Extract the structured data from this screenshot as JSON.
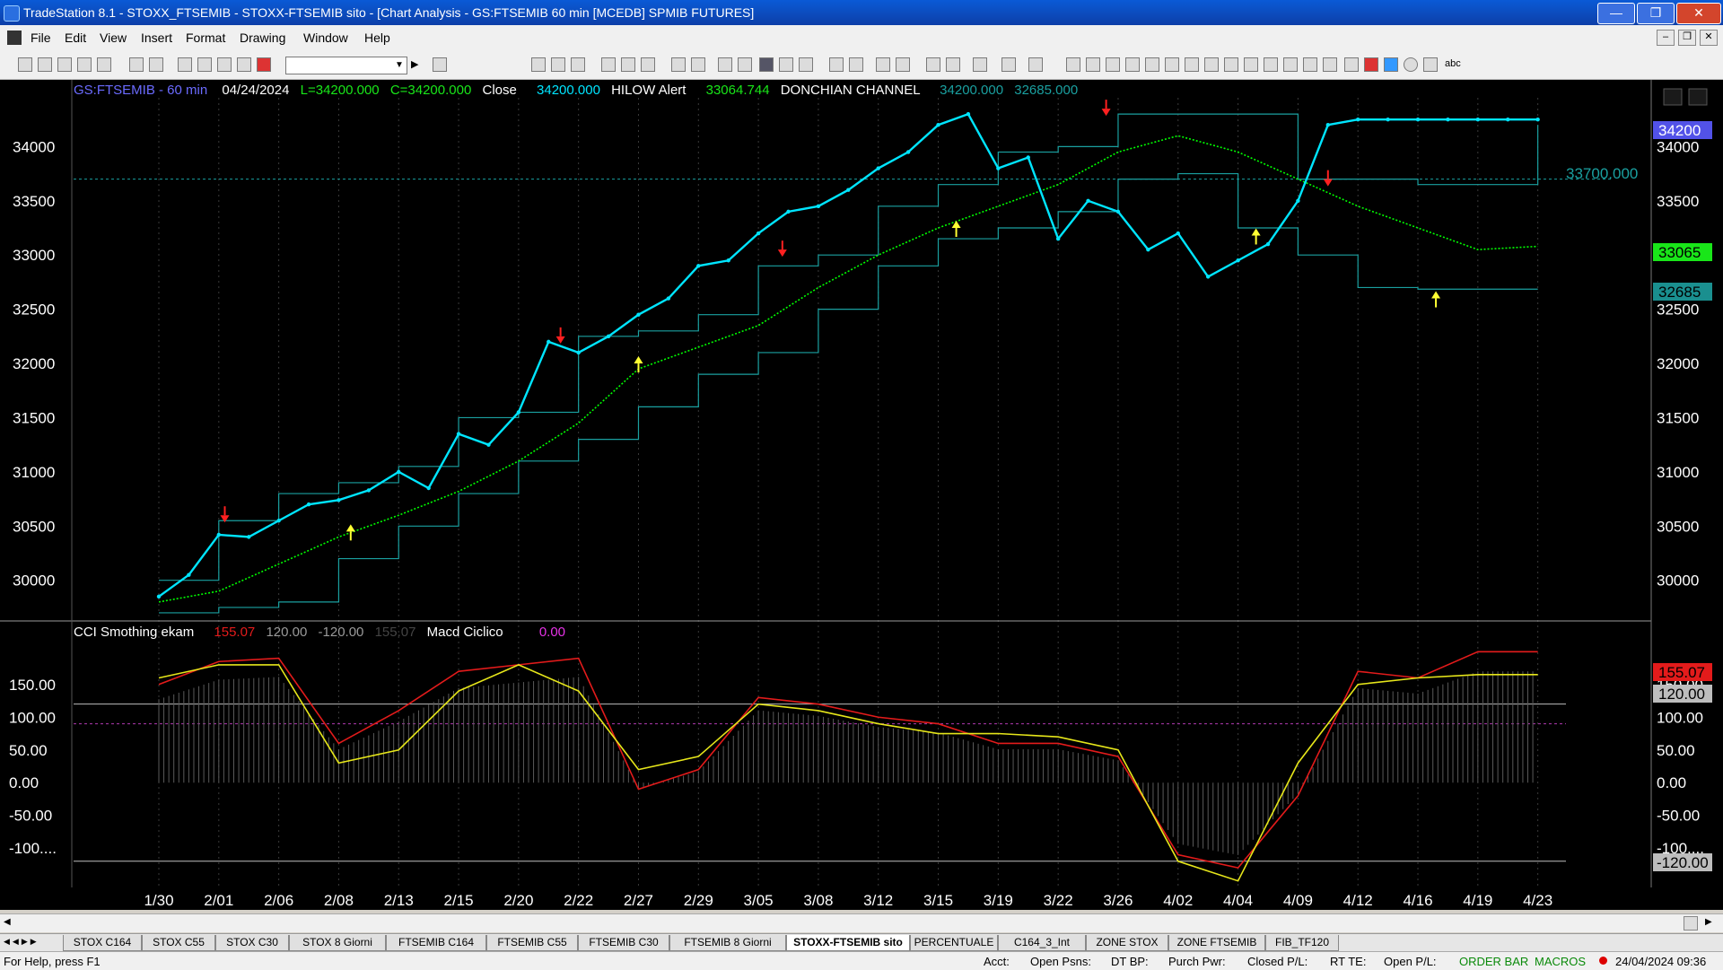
{
  "window": {
    "title": "TradeStation 8.1 - STOXX_FTSEMIB - STOXX-FTSEMIB sito - [Chart Analysis - GS:FTSEMIB  60 min  [MCEDB] SPMIB FUTURES]",
    "minimize_icon": "minimize-icon",
    "maximize_icon": "maximize-icon",
    "close_icon": "close-icon"
  },
  "menu": {
    "items": [
      "File",
      "Edit",
      "View",
      "Insert",
      "Format",
      "Drawing",
      "Window",
      "Help"
    ]
  },
  "chart": {
    "header": {
      "symbol": "GS:FTSEMIB - 60 min",
      "date": "04/24/2024",
      "low": "L=34200.000",
      "close_field": "C=34200.000",
      "close_label": "Close",
      "close_value": "34200.000",
      "hilow_label": "HILOW Alert",
      "hilow_value": "33064.744",
      "donchian_label": "DONCHIAN CHANNEL",
      "donchian_upper": "34200.000",
      "donchian_lower": "32685.000"
    },
    "level_label": "33700.000",
    "price_badges": {
      "last": "34200",
      "hilow": "33065",
      "donchian_lower": "32685"
    },
    "lower_header": {
      "cci_label": "CCI Smothing ekam",
      "cci_value": "155.07",
      "upper_band": "120.00",
      "lower_band": "-120.00",
      "cci_value_dim": "155.07",
      "macd_label": "Macd Ciclico",
      "macd_value": "0.00"
    },
    "lower_badges": {
      "cci": "155.07",
      "upper": "120.00",
      "lower": "-120.00"
    },
    "colors": {
      "price": "#00e5ff",
      "ma": "#00ff00",
      "donchian": "#1aa0a0",
      "cci": "#e31b1b",
      "signal": "#e6e61a",
      "hist": "#9a9a9a"
    }
  },
  "chart_data": {
    "type": "line",
    "x_labels": [
      "1/30",
      "2/01",
      "2/06",
      "2/08",
      "2/13",
      "2/15",
      "2/20",
      "2/22",
      "2/27",
      "2/29",
      "3/05",
      "3/08",
      "3/12",
      "3/15",
      "3/19",
      "3/22",
      "3/26",
      "4/02",
      "4/04",
      "4/09",
      "4/12",
      "4/16",
      "4/19",
      "4/23"
    ],
    "price_axis": {
      "ticks": [
        "34000",
        "33500",
        "33000",
        "32500",
        "32000",
        "31500",
        "31000",
        "30500",
        "30000"
      ],
      "ylim": [
        29650,
        34450
      ]
    },
    "indicator_axis": {
      "ticks": [
        "150.00",
        "100.00",
        "50.00",
        "0.00",
        "-50.00",
        "-100...."
      ],
      "ylim": [
        -160,
        210
      ]
    },
    "series": [
      {
        "name": "Close",
        "x": [
          0,
          0.5,
          1,
          1.5,
          2,
          2.5,
          3,
          3.5,
          4,
          4.5,
          5,
          5.5,
          6,
          6.5,
          7,
          7.5,
          8,
          8.5,
          9,
          9.5,
          10,
          10.5,
          11,
          11.5,
          12,
          12.5,
          13,
          13.5,
          14,
          14.5,
          15,
          15.5,
          16,
          16.5,
          17,
          17.5,
          18,
          18.5,
          19,
          19.5,
          20,
          20.5,
          21,
          21.5,
          22,
          22.5,
          23
        ],
        "values": [
          29850,
          30050,
          30420,
          30400,
          30550,
          30700,
          30740,
          30830,
          31000,
          30850,
          31350,
          31250,
          31550,
          32200,
          32100,
          32250,
          32450,
          32600,
          32900,
          32950,
          33200,
          33400,
          33450,
          33600,
          33800,
          33950,
          34200,
          34300,
          33800,
          33900,
          33150,
          33500,
          33400,
          33050,
          33200,
          32800,
          32950,
          33100,
          33500,
          34200,
          34250,
          34250,
          34250,
          34250,
          34250,
          34250,
          34250
        ]
      },
      {
        "name": "HILOW Alert",
        "x": [
          0,
          1,
          2,
          3,
          4,
          5,
          6,
          7,
          8,
          9,
          10,
          11,
          12,
          13,
          14,
          15,
          16,
          17,
          18,
          19,
          20,
          21,
          22,
          23
        ],
        "values": [
          29800,
          29900,
          30150,
          30400,
          30600,
          30820,
          31100,
          31450,
          31950,
          32150,
          32350,
          32700,
          33000,
          33250,
          33450,
          33650,
          33950,
          34100,
          33950,
          33700,
          33450,
          33250,
          33050,
          33080
        ]
      },
      {
        "name": "DONCHIAN CHANNEL",
        "x": [
          0,
          1,
          2,
          3,
          4,
          5,
          6,
          7,
          8,
          9,
          10,
          11,
          12,
          13,
          14,
          15,
          16,
          17,
          18,
          19,
          20,
          21,
          22,
          23
        ],
        "values": [
          30000,
          30550,
          30800,
          30900,
          31050,
          31500,
          31550,
          32250,
          32300,
          32450,
          32900,
          33000,
          33450,
          33650,
          33950,
          34000,
          34300,
          34300,
          34300,
          33700,
          33700,
          33650,
          33650,
          34200
        ]
      },
      {
        "name": "DONCHIAN CHANNEL",
        "x": [
          0,
          1,
          2,
          3,
          4,
          5,
          6,
          7,
          8,
          9,
          10,
          11,
          12,
          13,
          14,
          15,
          16,
          17,
          18,
          19,
          20,
          21,
          22,
          23
        ],
        "values": [
          29700,
          29750,
          29800,
          30200,
          30500,
          30800,
          31100,
          31300,
          31600,
          31900,
          32100,
          32500,
          32900,
          33150,
          33250,
          33400,
          33700,
          33750,
          33250,
          33000,
          32700,
          32685,
          32685,
          32685
        ]
      },
      {
        "name": "CCI Smothing ekam",
        "x": [
          0,
          1,
          2,
          3,
          4,
          5,
          6,
          7,
          8,
          9,
          10,
          11,
          12,
          13,
          14,
          15,
          16,
          17,
          18,
          19,
          20,
          21,
          22,
          23
        ],
        "values": [
          150,
          185,
          190,
          60,
          110,
          170,
          180,
          190,
          -10,
          20,
          130,
          120,
          100,
          90,
          60,
          60,
          40,
          -110,
          -130,
          -20,
          170,
          160,
          200,
          200
        ]
      },
      {
        "name": "Macd Ciclico",
        "x": [
          0,
          1,
          2,
          3,
          4,
          5,
          6,
          7,
          8,
          9,
          10,
          11,
          12,
          13,
          14,
          15,
          16,
          17,
          18,
          19,
          20,
          21,
          22,
          23
        ],
        "values": [
          160,
          180,
          180,
          30,
          50,
          140,
          180,
          140,
          20,
          40,
          120,
          110,
          90,
          75,
          75,
          70,
          50,
          -120,
          -150,
          30,
          150,
          160,
          165,
          165
        ]
      }
    ]
  },
  "tabs": [
    "STOX C164",
    "STOX C55",
    "STOX  C30",
    "STOX  8 Giorni",
    "FTSEMIB C164",
    "FTSEMIB C55",
    "FTSEMIB C30",
    "FTSEMIB  8 Giorni",
    "STOXX-FTSEMIB sito",
    "PERCENTUALE",
    "C164_3_Int",
    "ZONE STOX",
    "ZONE FTSEMIB",
    "FIB_TF120"
  ],
  "active_tab": "STOXX-FTSEMIB sito",
  "status": {
    "help": "For Help, press F1",
    "acct": "Acct:",
    "open_psns": "Open Psns:",
    "dt_bp": "DT BP:",
    "purch_pwr": "Purch Pwr:",
    "closed_pl": "Closed P/L:",
    "rt_te": "RT TE:",
    "open_pl": "Open P/L:",
    "order_bar": "ORDER BAR",
    "macros": "MACROS",
    "datetime": "24/04/2024 09:36"
  }
}
